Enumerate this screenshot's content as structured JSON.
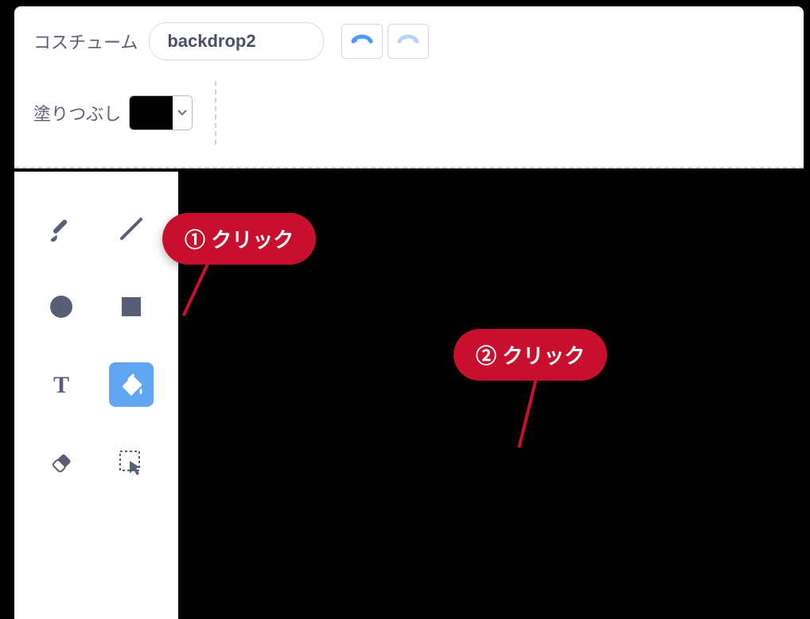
{
  "header": {
    "costume_label": "コスチューム",
    "costume_name": "backdrop2"
  },
  "fill": {
    "label": "塗りつぶし",
    "color": "#000000"
  },
  "tools": {
    "brush": "brush",
    "line": "line",
    "circle": "circle",
    "rect": "rectangle",
    "text": "text",
    "fill": "fill",
    "eraser": "eraser",
    "select": "select",
    "selected": "fill"
  },
  "annotations": {
    "step1": "① クリック",
    "step2": "② クリック"
  }
}
